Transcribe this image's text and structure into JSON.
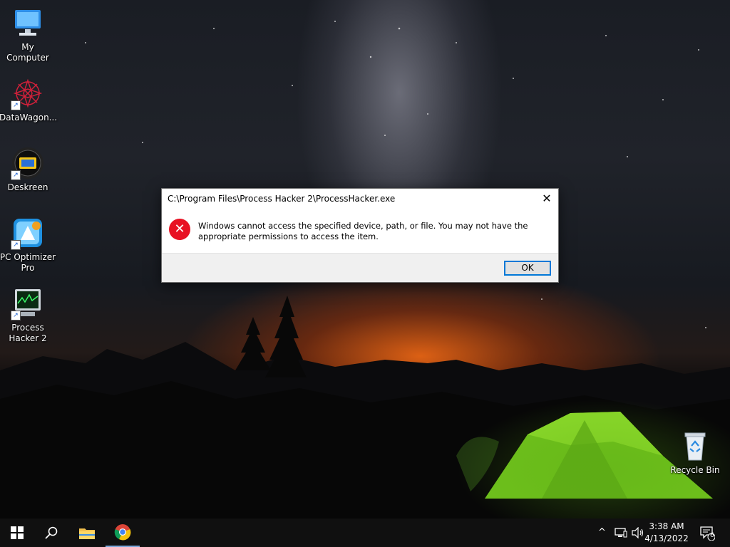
{
  "desktop_icons": [
    {
      "label_line1": "My Computer",
      "label_line2": "",
      "icon": "computer-icon"
    },
    {
      "label_line1": "DataWagon...",
      "label_line2": "",
      "icon": "datawagon-icon"
    },
    {
      "label_line1": "Deskreen",
      "label_line2": "",
      "icon": "deskreen-icon"
    },
    {
      "label_line1": "PC Optimizer",
      "label_line2": "Pro",
      "icon": "pc-optimizer-icon"
    },
    {
      "label_line1": "Process",
      "label_line2": "Hacker 2",
      "icon": "process-hacker-icon"
    },
    {
      "label_line1": "Recycle Bin",
      "label_line2": "",
      "icon": "recycle-bin-icon"
    }
  ],
  "dialog": {
    "title": "C:\\Program Files\\Process Hacker 2\\ProcessHacker.exe",
    "close_glyph": "✕",
    "icon": "error-icon",
    "message": "Windows cannot access the specified device, path, or file. You may not have the appropriate permissions to access the item.",
    "ok_label": "OK"
  },
  "taskbar": {
    "time": "3:38 AM",
    "date": "4/13/2022",
    "notification_count": "6",
    "items": [
      "start-icon",
      "search-icon",
      "file-explorer-icon",
      "chrome-icon"
    ],
    "tray": [
      "chevron-up-icon",
      "network-icon",
      "volume-icon",
      "notification-icon"
    ]
  },
  "colors": {
    "error_red": "#e81123",
    "accent_blue": "#0078d7",
    "taskbar_bg": "#101010"
  }
}
